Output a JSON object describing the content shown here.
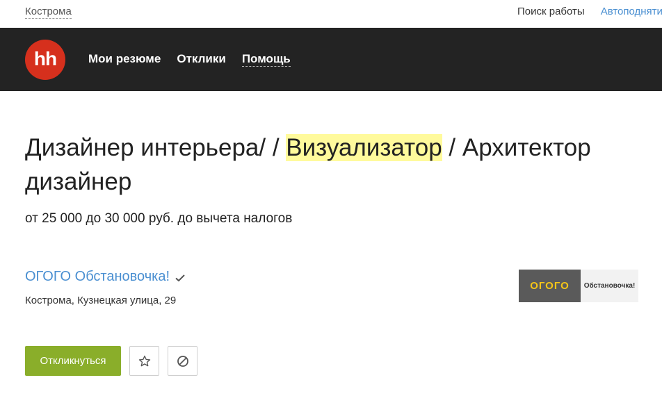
{
  "topbar": {
    "city": "Кострома",
    "search_jobs": "Поиск работы",
    "auto_link": "Автоподнятие"
  },
  "navbar": {
    "logo_text": "hh",
    "items": [
      {
        "label": "Мои резюме"
      },
      {
        "label": "Отклики"
      },
      {
        "label": "Помощь"
      }
    ]
  },
  "vacancy": {
    "title_part1": "Дизайнер интерьера/ / ",
    "title_highlight": "Визуализатор",
    "title_part2": " / Архитектор дизайнер",
    "salary": "от 25 000 до 30 000 руб. до вычета налогов",
    "company_name": "ОГОГО Обстановочка!",
    "address": "Кострома, Кузнецкая улица, 29",
    "logo_left": "ОГОГО",
    "logo_right": "Обстановочка!"
  },
  "actions": {
    "respond_label": "Откликнуться",
    "favorite_icon": "star-icon",
    "block_icon": "block-icon"
  },
  "colors": {
    "nav_bg": "#232323",
    "logo_red": "#d6301d",
    "link_blue": "#4a8fd1",
    "respond_green": "#8aae2a",
    "highlight_yellow": "#fffa9c"
  }
}
